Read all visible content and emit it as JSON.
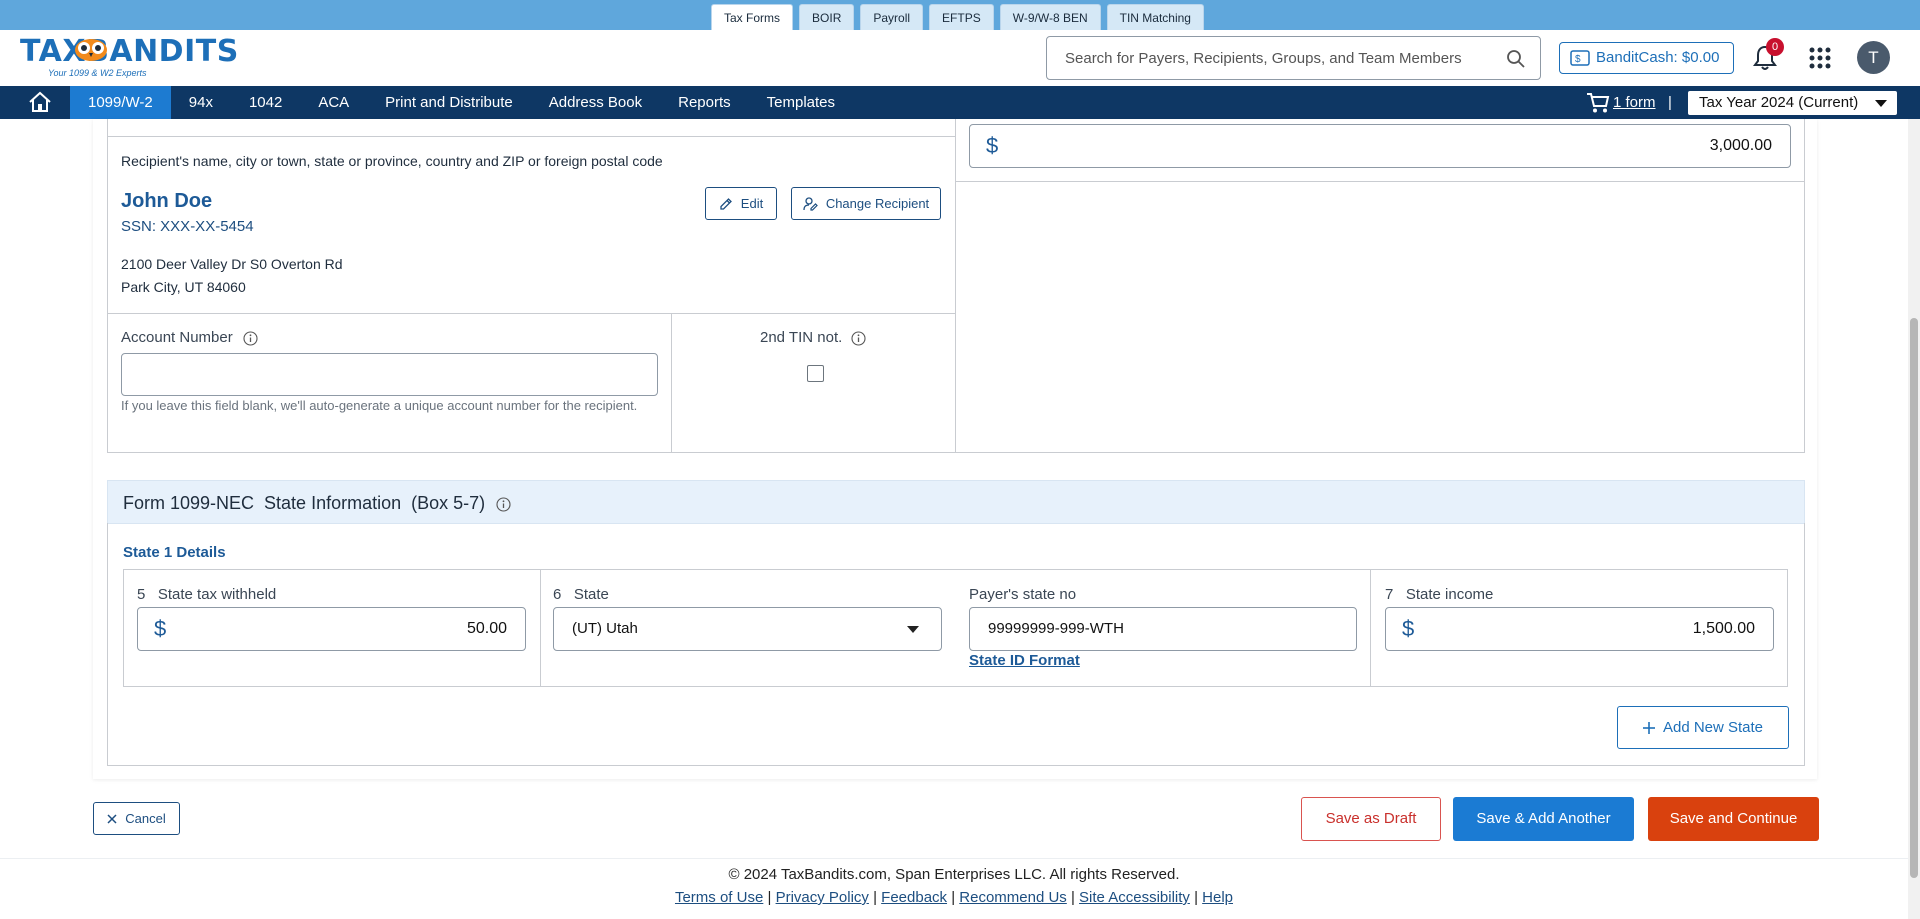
{
  "product_tabs": [
    {
      "label": "Tax Forms",
      "active": true
    },
    {
      "label": "BOIR"
    },
    {
      "label": "Payroll"
    },
    {
      "label": "EFTPS"
    },
    {
      "label": "W-9/W-8 BEN"
    },
    {
      "label": "TIN Matching"
    }
  ],
  "header": {
    "logo_text": "TAXBANDITS",
    "logo_tagline": "Your 1099 & W2 Experts",
    "search_placeholder": "Search for Payers, Recipients, Groups, and Team Members",
    "bandit_cash": "BanditCash: $0.00",
    "notification_count": "0",
    "avatar_initial": "T"
  },
  "nav": {
    "items": [
      "1099/W-2",
      "94x",
      "1042",
      "ACA",
      "Print and Distribute",
      "Address Book",
      "Reports",
      "Templates"
    ],
    "active_item": "1099/W-2",
    "cart_label": "1 form",
    "separator": "|",
    "tax_year": "Tax Year 2024 (Current)"
  },
  "recipient": {
    "section_label": "Recipient's name, city or town, state or province, country and ZIP or foreign postal code",
    "name": "John Doe",
    "ssn": "SSN: XXX-XX-5454",
    "address_line1": "2100 Deer Valley Dr S0 Overton Rd",
    "address_line2": "Park City, UT 84060",
    "edit_label": "Edit",
    "change_label": "Change Recipient"
  },
  "box_amount": {
    "value": "3,000.00"
  },
  "account": {
    "label": "Account Number",
    "value": "",
    "note": "If you leave this field blank, we'll auto-generate a unique account number for the recipient."
  },
  "tin_notice": {
    "label": "2nd TIN not.",
    "checked": false
  },
  "state_info": {
    "title": "Form 1099-NEC  State Information  (Box 5-7)",
    "details_title": "State 1 Details",
    "tax_withheld_label": "5   State tax withheld",
    "tax_withheld_value": "50.00",
    "state_label": "6   State",
    "state_value": "(UT) Utah",
    "payer_state_no_label": "Payer's state no",
    "payer_state_no_value": "99999999-999-WTH",
    "state_id_format_link": "State ID Format",
    "state_income_label": "7   State income",
    "state_income_value": "1,500.00",
    "add_state_label": "Add New State"
  },
  "actions": {
    "cancel": "Cancel",
    "save_draft": "Save as Draft",
    "save_add_another": "Save & Add Another",
    "save_continue": "Save and Continue"
  },
  "footer": {
    "copyright": "© 2024 TaxBandits.com, Span Enterprises LLC. All rights Reserved.",
    "links": [
      "Terms of Use",
      "Privacy Policy",
      "Feedback",
      "Recommend Us",
      "Site Accessibility",
      "Help"
    ]
  },
  "colors": {
    "brand_blue": "#1d6fb8",
    "nav_dark": "#0e3764",
    "nav_active": "#1d7bd1",
    "continue_orange": "#d9410e",
    "badge_red": "#c8102e"
  }
}
